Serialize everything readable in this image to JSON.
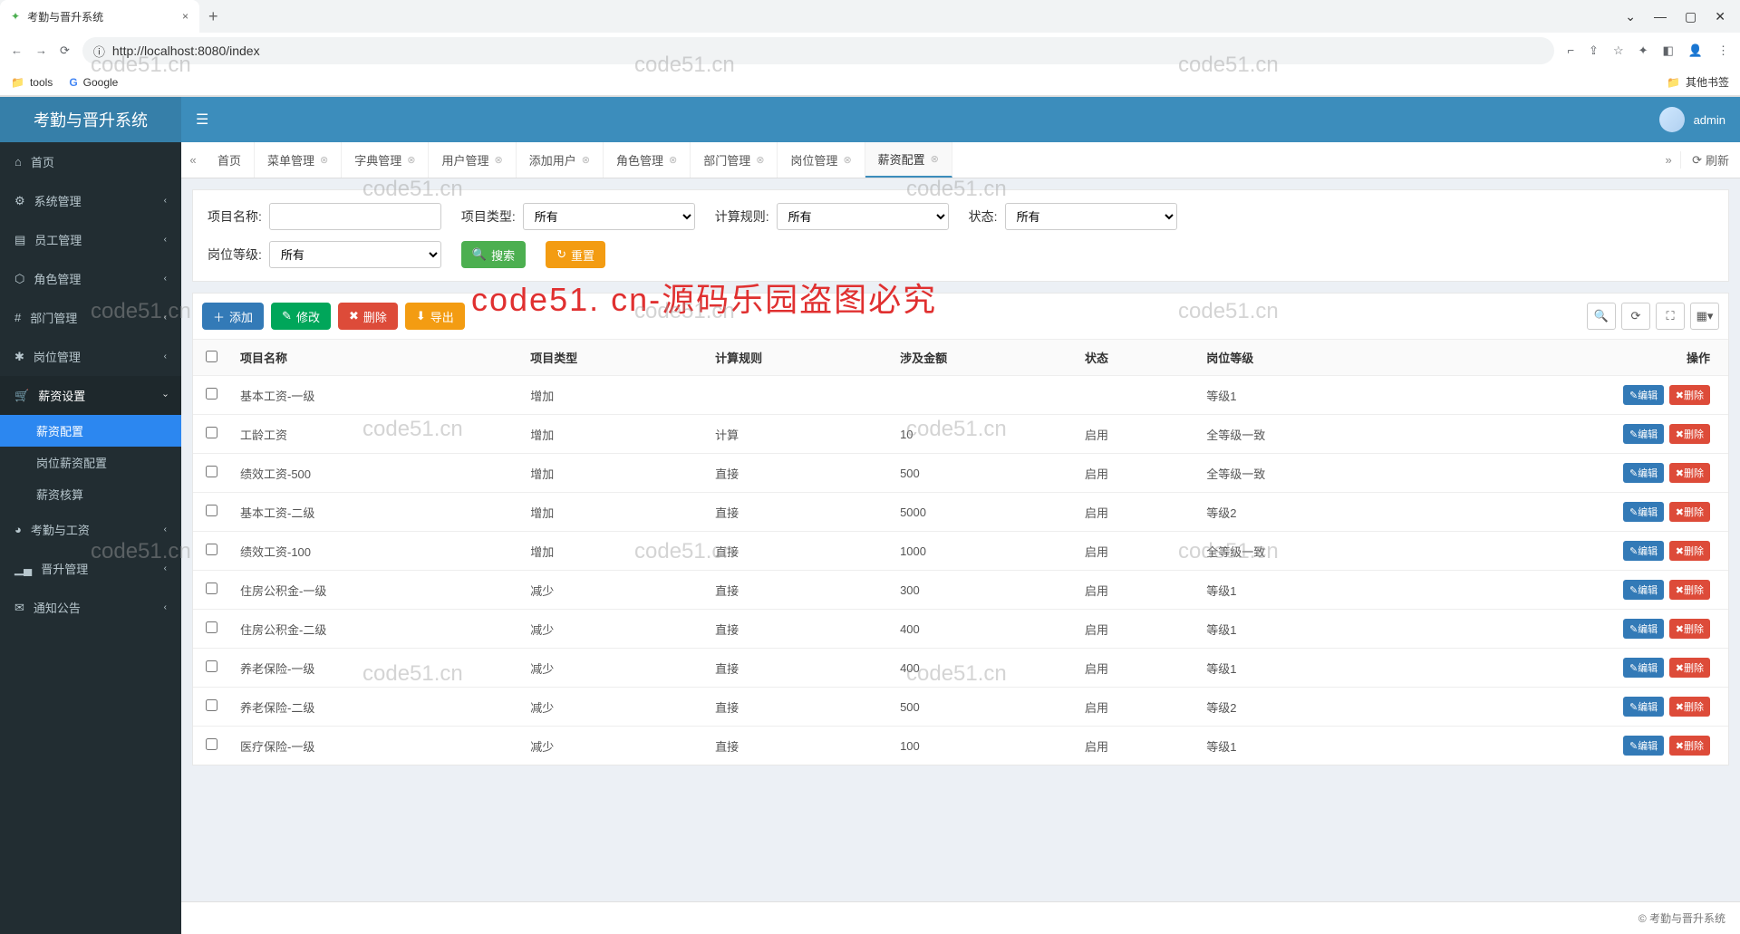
{
  "browser": {
    "tab_title": "考勤与晋升系统",
    "url": "http://localhost:8080/index",
    "bookmarks": {
      "tools": "tools",
      "google": "Google",
      "other": "其他书签"
    }
  },
  "app": {
    "brand": "考勤与晋升系统",
    "user": "admin"
  },
  "sidebar": {
    "items": [
      {
        "icon": "⌂",
        "label": "首页",
        "has_sub": false
      },
      {
        "icon": "⚙",
        "label": "系统管理",
        "has_sub": true
      },
      {
        "icon": "▤",
        "label": "员工管理",
        "has_sub": true
      },
      {
        "icon": "⬡",
        "label": "角色管理",
        "has_sub": true
      },
      {
        "icon": "#",
        "label": "部门管理",
        "has_sub": true
      },
      {
        "icon": "✱",
        "label": "岗位管理",
        "has_sub": true
      },
      {
        "icon": "🛒",
        "label": "薪资设置",
        "has_sub": true,
        "open": true,
        "subs": [
          {
            "label": "薪资配置",
            "active": true
          },
          {
            "label": "岗位薪资配置"
          },
          {
            "label": "薪资核算"
          }
        ]
      },
      {
        "icon": "◕",
        "label": "考勤与工资",
        "has_sub": true
      },
      {
        "icon": "▁▄",
        "label": "晋升管理",
        "has_sub": true
      },
      {
        "icon": "✉",
        "label": "通知公告",
        "has_sub": true
      }
    ]
  },
  "tabs": [
    {
      "label": "首页",
      "closable": false
    },
    {
      "label": "菜单管理"
    },
    {
      "label": "字典管理"
    },
    {
      "label": "用户管理"
    },
    {
      "label": "添加用户"
    },
    {
      "label": "角色管理"
    },
    {
      "label": "部门管理"
    },
    {
      "label": "岗位管理"
    },
    {
      "label": "薪资配置",
      "active": true
    }
  ],
  "tabs_right": {
    "refresh": "刷新"
  },
  "search": {
    "project_name_label": "项目名称:",
    "project_type_label": "项目类型:",
    "project_type_value": "所有",
    "calc_rule_label": "计算规则:",
    "calc_rule_value": "所有",
    "status_label": "状态:",
    "status_value": "所有",
    "post_level_label": "岗位等级:",
    "post_level_value": "所有",
    "search_btn": "搜索",
    "reset_btn": "重置"
  },
  "toolbar": {
    "add": "添加",
    "edit": "修改",
    "delete": "删除",
    "export": "导出"
  },
  "table": {
    "headers": [
      "项目名称",
      "项目类型",
      "计算规则",
      "涉及金额",
      "状态",
      "岗位等级",
      "操作"
    ],
    "rows": [
      {
        "name": "基本工资-一级",
        "type": "增加",
        "rule": "",
        "amount": "",
        "status": "",
        "level": "等级1"
      },
      {
        "name": "工龄工资",
        "type": "增加",
        "rule": "计算",
        "amount": "10",
        "status": "启用",
        "level": "全等级一致"
      },
      {
        "name": "绩效工资-500",
        "type": "增加",
        "rule": "直接",
        "amount": "500",
        "status": "启用",
        "level": "全等级一致"
      },
      {
        "name": "基本工资-二级",
        "type": "增加",
        "rule": "直接",
        "amount": "5000",
        "status": "启用",
        "level": "等级2"
      },
      {
        "name": "绩效工资-100",
        "type": "增加",
        "rule": "直接",
        "amount": "1000",
        "status": "启用",
        "level": "全等级一致"
      },
      {
        "name": "住房公积金-一级",
        "type": "减少",
        "rule": "直接",
        "amount": "300",
        "status": "启用",
        "level": "等级1"
      },
      {
        "name": "住房公积金-二级",
        "type": "减少",
        "rule": "直接",
        "amount": "400",
        "status": "启用",
        "level": "等级1"
      },
      {
        "name": "养老保险-一级",
        "type": "减少",
        "rule": "直接",
        "amount": "400",
        "status": "启用",
        "level": "等级1"
      },
      {
        "name": "养老保险-二级",
        "type": "减少",
        "rule": "直接",
        "amount": "500",
        "status": "启用",
        "level": "等级2"
      },
      {
        "name": "医疗保险-一级",
        "type": "减少",
        "rule": "直接",
        "amount": "100",
        "status": "启用",
        "level": "等级1"
      }
    ],
    "row_edit": "编辑",
    "row_delete": "删除"
  },
  "footer": {
    "copyright": "© 考勤与晋升系统"
  },
  "watermarks": {
    "gray": "code51.cn",
    "red": "code51. cn-源码乐园盗图必究"
  }
}
